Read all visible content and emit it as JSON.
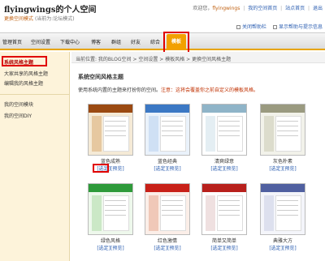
{
  "header": {
    "site_title": "flyingwings的个人空间",
    "mode_label": "更换空间模式",
    "mode_hint": "(当前为:论坛模式)",
    "welcome": "欢迎您，",
    "username": "flyingwings",
    "links": [
      "我的空间首页",
      "站点首页",
      "退出"
    ],
    "help_close": "关闭帮助栏",
    "help_show": "显示帮助与提示信息"
  },
  "nav": {
    "items": [
      "管理首页",
      "空间设置",
      "下载中心",
      "博客",
      "群组",
      "好友",
      "綜合"
    ],
    "active": "模板"
  },
  "sidebar": {
    "items": [
      "系统风格主题",
      "大家共享的风格主题",
      "编辑我的风格主题",
      "我的空间模块",
      "我的空间DIY"
    ]
  },
  "breadcrumb": "当前位置: 我的BLOG空间 > 空间设置 > 模板风格 > 更换空间风格主题",
  "section_title": "系统空间风格主题",
  "description": {
    "text": "使用系统内置的主题来打扮你的空间。",
    "warning": "注意：这将会覆盖你之前自定义的模板风格。"
  },
  "theme_actions": {
    "select": "[选定]",
    "preview": "[预览]"
  },
  "themes": [
    {
      "name": "蓝色成熟",
      "colors": {
        "band": "#9b4a12",
        "side": "#e6c8a0",
        "bg": "#f5ead6"
      }
    },
    {
      "name": "蓝色经典",
      "colors": {
        "band": "#3b78c4",
        "side": "#cfe0f4",
        "bg": "#eaf2fb"
      }
    },
    {
      "name": "清爽绿意",
      "colors": {
        "band": "#8fb4c8",
        "side": "#e4eef3",
        "bg": "#ffffff"
      }
    },
    {
      "name": "灰色朴素",
      "colors": {
        "band": "#9a9a80",
        "side": "#dcdccc",
        "bg": "#f2f2ea"
      }
    },
    {
      "name": "绿色风格",
      "colors": {
        "band": "#2e9a3a",
        "side": "#cbe8c6",
        "bg": "#eef8ec"
      }
    },
    {
      "name": "红色激情",
      "colors": {
        "band": "#c82018",
        "side": "#f0c8b8",
        "bg": "#fbeee8"
      }
    },
    {
      "name": "简单又简单",
      "colors": {
        "band": "#b8201c",
        "side": "#efe0e0",
        "bg": "#ffffff"
      }
    },
    {
      "name": "典雅大方",
      "colors": {
        "band": "#5060a0",
        "side": "#dde0ee",
        "bg": "#f4f5fa"
      }
    }
  ]
}
